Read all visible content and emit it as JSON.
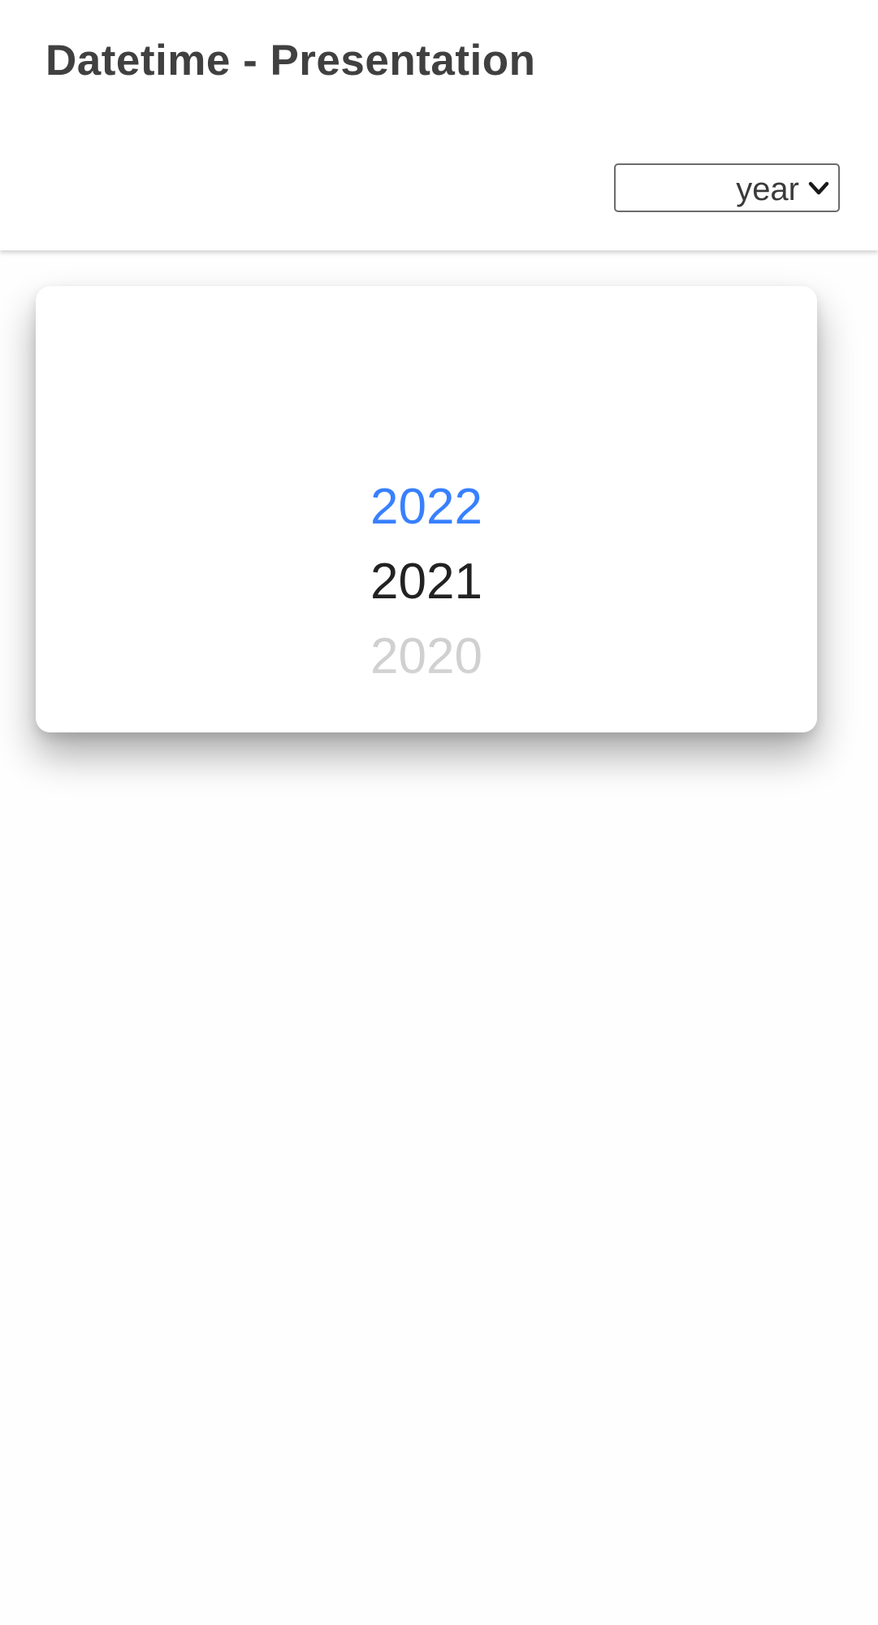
{
  "header": {
    "title": "Datetime - Presentation"
  },
  "presentation_select": {
    "selected": "year",
    "icon": "chevron-down-icon"
  },
  "year_wheel": {
    "items": [
      "2022",
      "2021",
      "2020"
    ],
    "selected": "2022"
  },
  "colors": {
    "accent": "#3880ff",
    "title": "#404040",
    "text": "#222222"
  }
}
